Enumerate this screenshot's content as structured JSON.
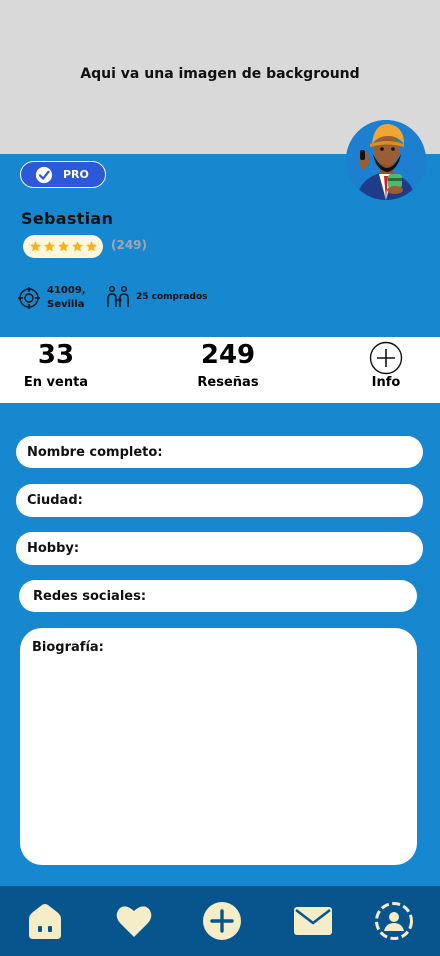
{
  "header": {
    "background_text": "Aqui va una imagen de background"
  },
  "profile": {
    "badge": "PRO",
    "name": "Sebastian",
    "rating_count": "(249)",
    "rating_stars": 5,
    "location": {
      "line1": "41009,",
      "line2": "Sevilla"
    },
    "purchases": "25 comprados"
  },
  "stats": [
    {
      "value": "33",
      "label": "En venta"
    },
    {
      "value": "249",
      "label": "Reseñas"
    },
    {
      "label": "Info"
    }
  ],
  "form": {
    "full_name": "Nombre completo:",
    "city": "Ciudad:",
    "hobby": "Hobby:",
    "social": "Redes sociales:",
    "bio": "Biografía:"
  },
  "nav": {
    "items": [
      "home-icon",
      "heart-icon",
      "plus-icon",
      "mail-icon",
      "profile-icon"
    ]
  },
  "colors": {
    "primary_blue": "#1787cf",
    "nav_blue": "#08558e",
    "cream": "#f5ecc8",
    "pro_badge": "#2d58d8",
    "star": "#f5b21c"
  }
}
